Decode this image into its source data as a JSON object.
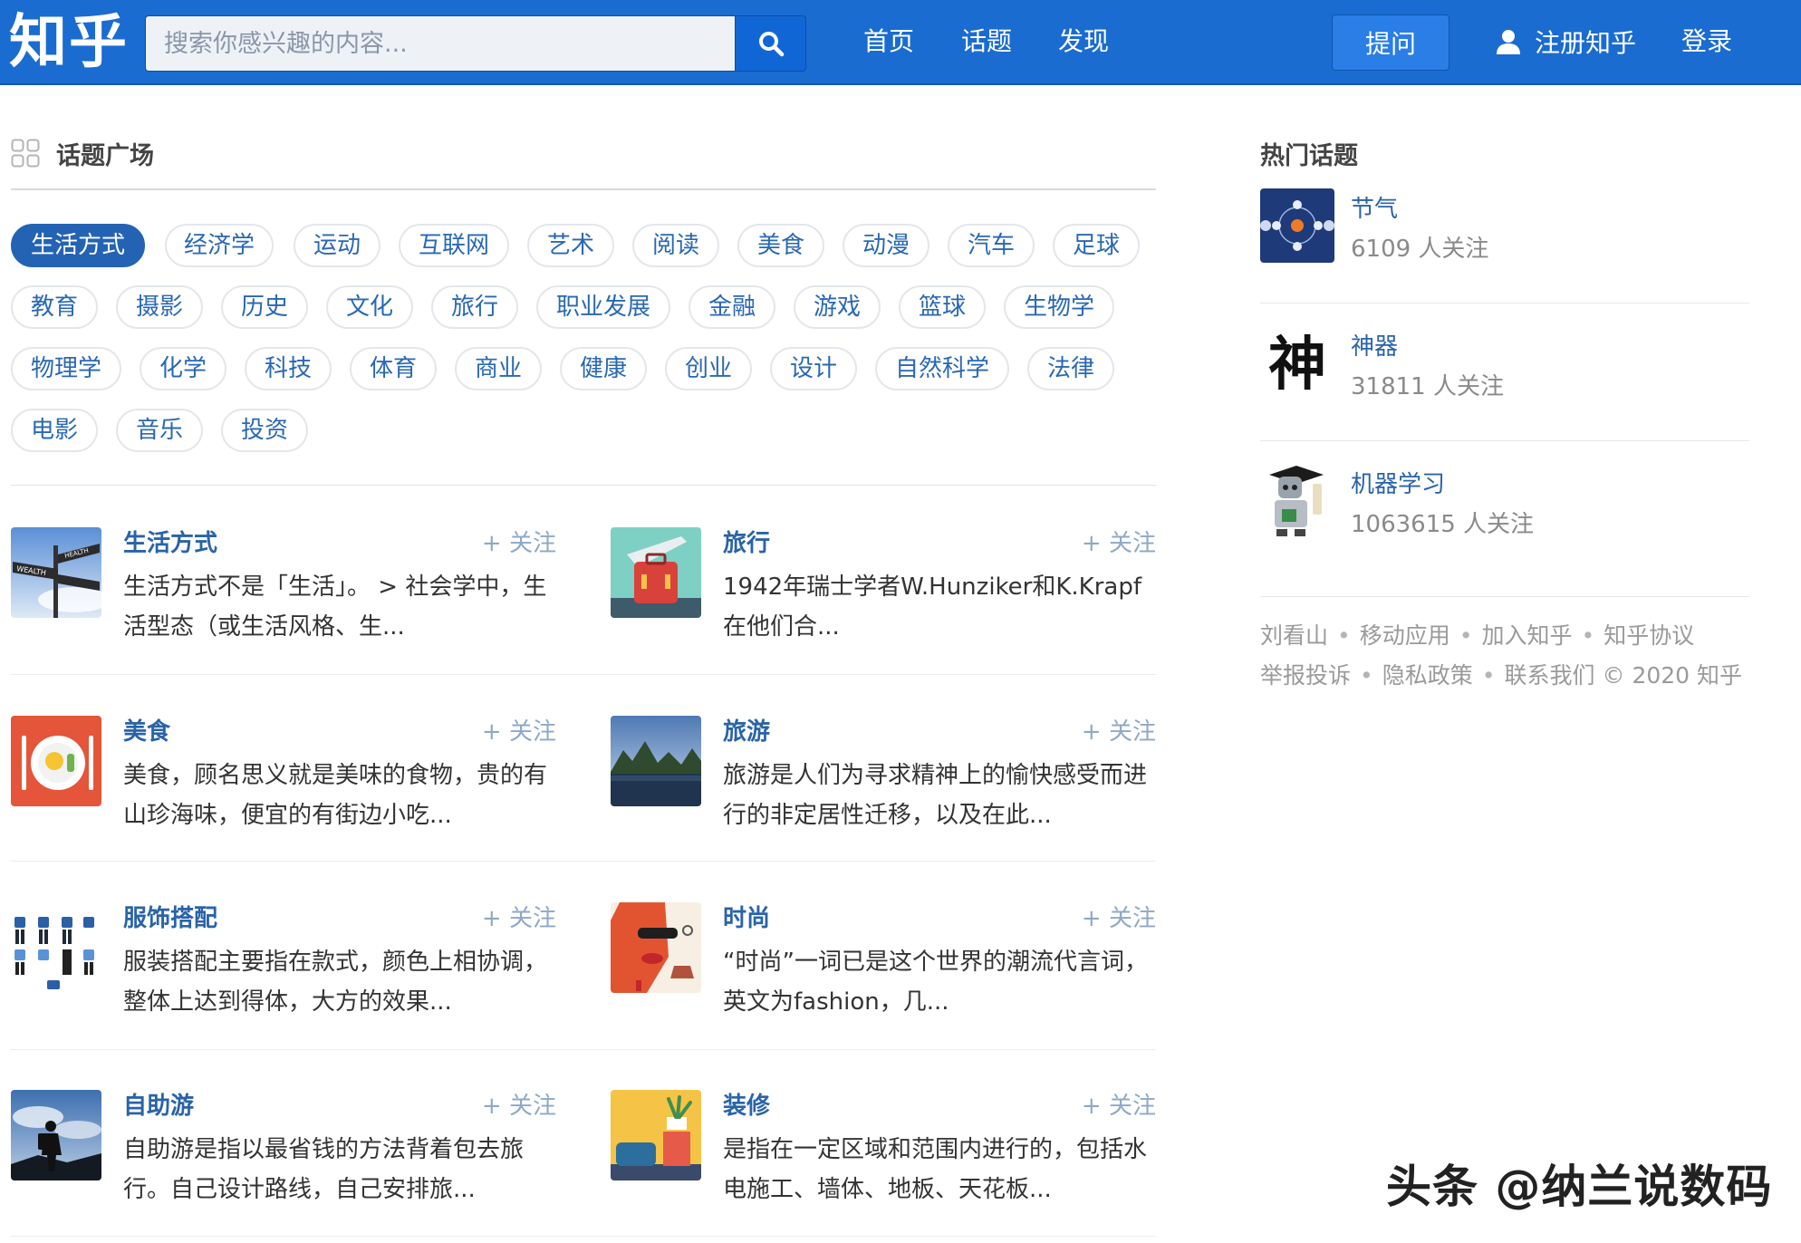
{
  "header": {
    "logo": "知乎",
    "search_placeholder": "搜索你感兴趣的内容...",
    "nav": [
      "首页",
      "话题",
      "发现"
    ],
    "ask_label": "提问",
    "register_label": "注册知乎",
    "login_label": "登录"
  },
  "square": {
    "title": "话题广场",
    "tags": [
      "生活方式",
      "经济学",
      "运动",
      "互联网",
      "艺术",
      "阅读",
      "美食",
      "动漫",
      "汽车",
      "足球",
      "教育",
      "摄影",
      "历史",
      "文化",
      "旅行",
      "职业发展",
      "金融",
      "游戏",
      "篮球",
      "生物学",
      "物理学",
      "化学",
      "科技",
      "体育",
      "商业",
      "健康",
      "创业",
      "设计",
      "自然科学",
      "法律",
      "电影",
      "音乐",
      "投资"
    ],
    "active_tag": "生活方式"
  },
  "topics": [
    {
      "name": "生活方式",
      "follow": "关注",
      "desc": "生活方式不是「生活」。 > 社会学中，生活型态（或生活风格、生..."
    },
    {
      "name": "旅行",
      "follow": "关注",
      "desc": "1942年瑞士学者W.Hunziker和K.Krapf在他们合..."
    },
    {
      "name": "美食",
      "follow": "关注",
      "desc": "美食，顾名思义就是美味的食物，贵的有山珍海味，便宜的有街边小吃..."
    },
    {
      "name": "旅游",
      "follow": "关注",
      "desc": "旅游是人们为寻求精神上的愉快感受而进行的非定居性迁移，以及在此..."
    },
    {
      "name": "服饰搭配",
      "follow": "关注",
      "desc": "服装搭配主要指在款式，颜色上相协调，整体上达到得体，大方的效果..."
    },
    {
      "name": "时尚",
      "follow": "关注",
      "desc": "“时尚”一词已是这个世界的潮流代言词，英文为fashion，几..."
    },
    {
      "name": "自助游",
      "follow": "关注",
      "desc": "自助游是指以最省钱的方法背着包去旅行。自己设计路线，自己安排旅..."
    },
    {
      "name": "装修",
      "follow": "关注",
      "desc": "是指在一定区域和范围内进行的，包括水电施工、墙体、地板、天花板..."
    }
  ],
  "hot": {
    "title": "热门话题",
    "items": [
      {
        "name": "节气",
        "count": "6109 人关注"
      },
      {
        "name": "神器",
        "count": "31811 人关注"
      },
      {
        "name": "机器学习",
        "count": "1063615 人关注"
      }
    ]
  },
  "footer": {
    "links": [
      "刘看山",
      "移动应用",
      "加入知乎",
      "知乎协议",
      "举报投诉",
      "隐私政策",
      "联系我们"
    ],
    "copyright": "© 2020 知乎"
  },
  "watermark": "头条 @纳兰说数码"
}
